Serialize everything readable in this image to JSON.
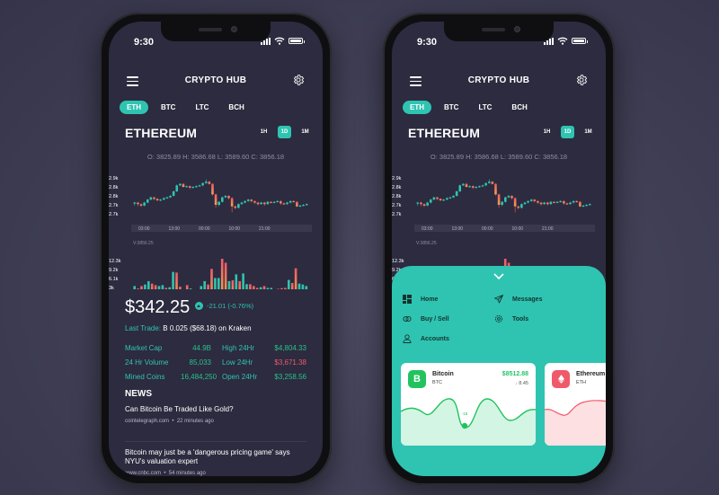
{
  "status_bar": {
    "time": "9:30"
  },
  "header": {
    "title": "CRYPTO HUB"
  },
  "coin_tabs": [
    {
      "label": "ETH",
      "active": true
    },
    {
      "label": "BTC",
      "active": false
    },
    {
      "label": "LTC",
      "active": false
    },
    {
      "label": "BCH",
      "active": false
    }
  ],
  "coin_title": "ETHEREUM",
  "range_tabs": [
    {
      "label": "1H",
      "active": false
    },
    {
      "label": "1D",
      "active": true
    },
    {
      "label": "1M",
      "active": false
    }
  ],
  "ohlc": "O: 3825.89  H: 3586.68  L: 3589.60  C: 3856.18",
  "price_chart": {
    "type": "candlestick",
    "y_ticks": [
      "2.9k",
      "2.8k",
      "2.8k",
      "2.7k",
      "2.7k"
    ],
    "x_ticks": [
      "03:00",
      "13:00",
      "00:00",
      "10:00",
      "21:00"
    ],
    "volume_readout": "V:3856.25",
    "candles": [
      [
        2.72,
        2.725,
        2.705,
        2.73
      ],
      [
        2.725,
        2.715,
        2.7,
        2.73
      ],
      [
        2.715,
        2.705,
        2.695,
        2.72
      ],
      [
        2.705,
        2.725,
        2.7,
        2.73
      ],
      [
        2.725,
        2.745,
        2.72,
        2.75
      ],
      [
        2.745,
        2.76,
        2.74,
        2.765
      ],
      [
        2.76,
        2.75,
        2.74,
        2.765
      ],
      [
        2.75,
        2.74,
        2.735,
        2.755
      ],
      [
        2.74,
        2.745,
        2.735,
        2.75
      ],
      [
        2.745,
        2.755,
        2.74,
        2.76
      ],
      [
        2.755,
        2.76,
        2.75,
        2.765
      ],
      [
        2.76,
        2.77,
        2.755,
        2.775
      ],
      [
        2.77,
        2.8,
        2.765,
        2.805
      ],
      [
        2.8,
        2.84,
        2.795,
        2.845
      ],
      [
        2.84,
        2.85,
        2.835,
        2.855
      ],
      [
        2.85,
        2.83,
        2.825,
        2.855
      ],
      [
        2.83,
        2.835,
        2.825,
        2.84
      ],
      [
        2.835,
        2.825,
        2.815,
        2.84
      ],
      [
        2.825,
        2.83,
        2.82,
        2.835
      ],
      [
        2.83,
        2.835,
        2.825,
        2.84
      ],
      [
        2.835,
        2.84,
        2.83,
        2.845
      ],
      [
        2.84,
        2.855,
        2.835,
        2.86
      ],
      [
        2.855,
        2.865,
        2.85,
        2.88
      ],
      [
        2.865,
        2.85,
        2.845,
        2.87
      ],
      [
        2.85,
        2.78,
        2.77,
        2.855
      ],
      [
        2.78,
        2.71,
        2.69,
        2.785
      ],
      [
        2.71,
        2.73,
        2.7,
        2.735
      ],
      [
        2.73,
        2.76,
        2.725,
        2.765
      ],
      [
        2.76,
        2.77,
        2.755,
        2.775
      ],
      [
        2.77,
        2.755,
        2.745,
        2.775
      ],
      [
        2.755,
        2.7,
        2.66,
        2.76
      ],
      [
        2.7,
        2.69,
        2.68,
        2.705
      ],
      [
        2.69,
        2.715,
        2.685,
        2.72
      ],
      [
        2.715,
        2.725,
        2.71,
        2.73
      ],
      [
        2.725,
        2.735,
        2.72,
        2.74
      ],
      [
        2.735,
        2.745,
        2.73,
        2.75
      ],
      [
        2.745,
        2.735,
        2.725,
        2.75
      ],
      [
        2.735,
        2.725,
        2.715,
        2.74
      ],
      [
        2.725,
        2.715,
        2.705,
        2.73
      ],
      [
        2.715,
        2.725,
        2.71,
        2.73
      ],
      [
        2.725,
        2.715,
        2.705,
        2.73
      ],
      [
        2.715,
        2.73,
        2.71,
        2.735
      ],
      [
        2.73,
        2.725,
        2.72,
        2.735
      ],
      [
        2.725,
        2.73,
        2.72,
        2.735
      ],
      [
        2.73,
        2.735,
        2.725,
        2.74
      ],
      [
        2.735,
        2.72,
        2.71,
        2.74
      ],
      [
        2.72,
        2.715,
        2.71,
        2.725
      ],
      [
        2.715,
        2.725,
        2.71,
        2.73
      ],
      [
        2.725,
        2.735,
        2.72,
        2.74
      ],
      [
        2.735,
        2.73,
        2.725,
        2.74
      ],
      [
        2.73,
        2.7,
        2.695,
        2.735
      ],
      [
        2.7,
        2.705,
        2.695,
        2.71
      ],
      [
        2.705,
        2.71,
        2.7,
        2.715
      ],
      [
        2.71,
        2.715,
        2.705,
        2.72
      ]
    ],
    "volume_y_ticks": [
      "12.3k",
      "9.2k",
      "6.1k",
      "3k"
    ],
    "volumes": [
      [
        3.4,
        "u"
      ],
      [
        2.6,
        "d"
      ],
      [
        3.4,
        "d"
      ],
      [
        3.9,
        "u"
      ],
      [
        5.0,
        "u"
      ],
      [
        4.2,
        "d"
      ],
      [
        3.7,
        "d"
      ],
      [
        3.4,
        "u"
      ],
      [
        3.7,
        "u"
      ],
      [
        2.8,
        "d"
      ],
      [
        3.0,
        "u"
      ],
      [
        8.0,
        "u"
      ],
      [
        7.8,
        "d"
      ],
      [
        3.2,
        "d"
      ],
      [
        2.2,
        "u"
      ],
      [
        3.7,
        "d"
      ],
      [
        2.6,
        "u"
      ],
      [
        1.9,
        "d"
      ],
      [
        2.0,
        "u"
      ],
      [
        3.4,
        "u"
      ],
      [
        5.0,
        "u"
      ],
      [
        3.9,
        "d"
      ],
      [
        9.0,
        "d"
      ],
      [
        6.0,
        "u"
      ],
      [
        6.0,
        "u"
      ],
      [
        12.3,
        "d"
      ],
      [
        11.0,
        "d"
      ],
      [
        5.0,
        "u"
      ],
      [
        5.3,
        "d"
      ],
      [
        7.2,
        "u"
      ],
      [
        5.0,
        "d"
      ],
      [
        7.5,
        "u"
      ],
      [
        4.0,
        "u"
      ],
      [
        4.0,
        "d"
      ],
      [
        3.4,
        "d"
      ],
      [
        2.8,
        "d"
      ],
      [
        3.0,
        "u"
      ],
      [
        3.4,
        "d"
      ],
      [
        2.8,
        "u"
      ],
      [
        2.8,
        "u"
      ],
      [
        2.0,
        "u"
      ],
      [
        2.5,
        "d"
      ],
      [
        2.7,
        "d"
      ],
      [
        2.8,
        "d"
      ],
      [
        5.4,
        "u"
      ],
      [
        4.4,
        "d"
      ],
      [
        9.2,
        "d"
      ],
      [
        4.2,
        "u"
      ],
      [
        3.9,
        "u"
      ],
      [
        3.4,
        "u"
      ]
    ]
  },
  "price": "$342.25",
  "change": "-21.01 (-0.76%)",
  "last_trade": {
    "label": "Last Trade:",
    "value": "B 0.025 ($68.18)  on Kraken"
  },
  "stats": [
    {
      "k1": "Market Cap",
      "v1": "44.9B",
      "k2": "High 24Hr",
      "v2": "$4,804.33",
      "v2_negative": false
    },
    {
      "k1": "24 Hr Volume",
      "v1": "85,033",
      "k2": "Low 24Hr",
      "v2": "$3,671.38",
      "v2_negative": true
    },
    {
      "k1": "Mined Coins",
      "v1": "16,484,250",
      "k2": "Open 24Hr",
      "v2": "$3,258.56",
      "v2_negative": false
    }
  ],
  "news": {
    "title": "NEWS",
    "items": [
      {
        "headline": "Can Bitcoin Be Traded Like Gold?",
        "source": "cointelegraph.com",
        "time": "22 minutes ago"
      },
      {
        "headline": "Bitcoin may just be a 'dangerous pricing game' says NYU's valuation expert",
        "source": "www.cnbc.com",
        "time": "54 minutes ago"
      }
    ]
  },
  "bottom_sheet": {
    "menu": [
      {
        "label": "Home",
        "icon": "dashboard-icon"
      },
      {
        "label": "Messages",
        "icon": "send-icon"
      },
      {
        "label": "Buy / Sell",
        "icon": "exchange-icon"
      },
      {
        "label": "Tools",
        "icon": "gear-icon"
      },
      {
        "label": "Accounts",
        "icon": "user-icon"
      }
    ],
    "cards": [
      {
        "name": "Bitcoin",
        "symbol": "BTC",
        "price": "$8512.88",
        "change": "8.45",
        "marker_label": "-18",
        "color": "#22c35e",
        "fill": "#d3f5e3"
      },
      {
        "name": "Ethereum",
        "symbol": "ETH",
        "color": "#ef5a6a",
        "fill": "#fde0e2"
      }
    ]
  },
  "colors": {
    "accent": "#2ec4b1",
    "up": "#2ec4b1",
    "down": "#ef5a6a",
    "positive_value": "#27c28a",
    "screen_bg": "#2d2b3f"
  }
}
